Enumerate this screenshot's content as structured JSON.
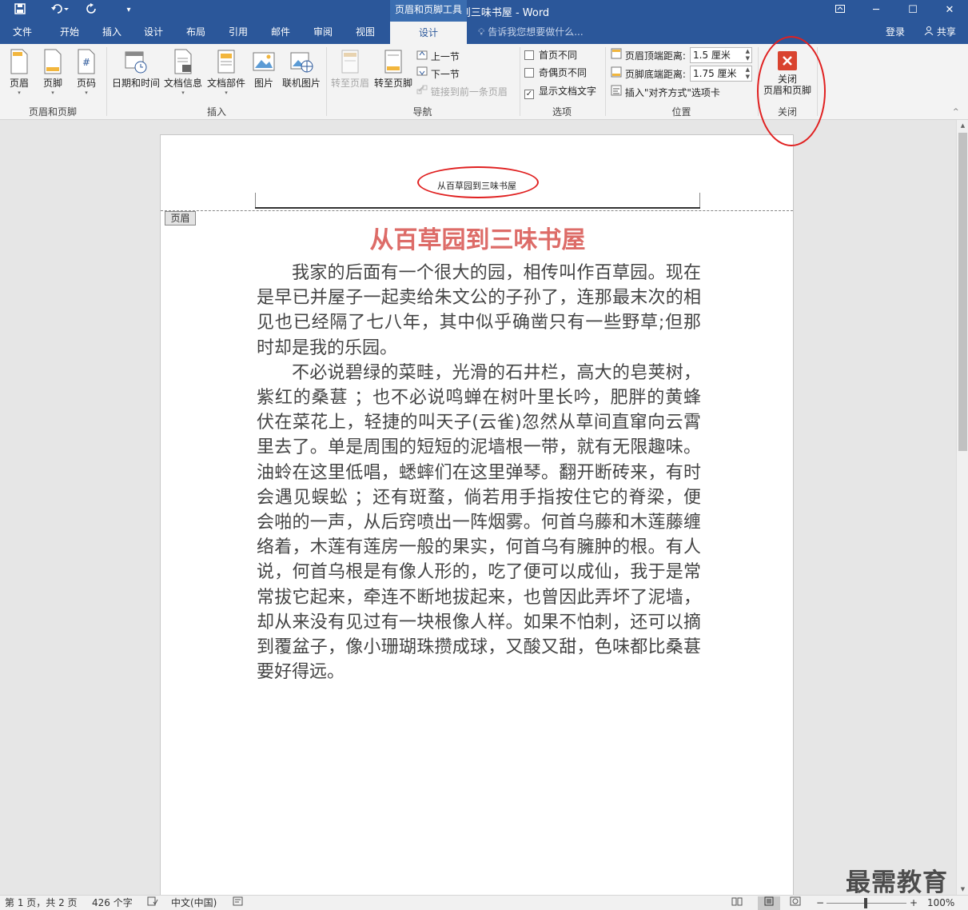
{
  "window": {
    "title": "从百草园到三味书屋 - Word",
    "context_tools": "页眉和页脚工具",
    "tell_me_placeholder": "告诉我您想要做什么...",
    "login": "登录",
    "share": "共享"
  },
  "menu": {
    "tabs": [
      "文件",
      "开始",
      "插入",
      "设计",
      "布局",
      "引用",
      "邮件",
      "审阅",
      "视图",
      "设计"
    ],
    "active_tab_index": 9
  },
  "ribbon": {
    "groups": {
      "header_footer": {
        "label": "页眉和页脚",
        "buttons": [
          "页眉",
          "页脚",
          "页码"
        ]
      },
      "insert": {
        "label": "插入",
        "buttons": [
          "日期和时间",
          "文档信息",
          "文档部件",
          "图片",
          "联机图片"
        ]
      },
      "navigation": {
        "label": "导航",
        "goto_header": "转至页眉",
        "goto_footer": "转至页脚",
        "prev_section": "上一节",
        "next_section": "下一节",
        "link_previous": "链接到前一条页眉"
      },
      "options": {
        "label": "选项",
        "first_page": "首页不同",
        "odd_even": "奇偶页不同",
        "show_doc_text": "显示文档文字"
      },
      "position": {
        "label": "位置",
        "header_from_top_label": "页眉顶端距离:",
        "header_from_top_value": "1.5 厘米",
        "footer_from_bottom_label": "页脚底端距离:",
        "footer_from_bottom_value": "1.75 厘米",
        "insert_align_tab": "插入\"对齐方式\"选项卡"
      },
      "close": {
        "label": "关闭",
        "button_line1": "关闭",
        "button_line2": "页眉和页脚"
      }
    }
  },
  "document": {
    "header_text": "从百草园到三味书屋",
    "header_tag": "页眉",
    "title": "从百草园到三味书屋",
    "paragraphs": [
      "我家的后面有一个很大的园，相传叫作百草园。现在是早已并屋子一起卖给朱文公的子孙了，连那最末次的相见也已经隔了七八年，其中似乎确凿只有一些野草;但那时却是我的乐园。",
      "不必说碧绿的菜畦，光滑的石井栏，高大的皂荚树，紫红的桑葚 ；也不必说鸣蝉在树叶里长吟，肥胖的黄蜂伏在菜花上，轻捷的叫天子(云雀)忽然从草间直窜向云霄里去了。单是周围的短短的泥墙根一带，就有无限趣味。油蛉在这里低唱，蟋蟀们在这里弹琴。翻开断砖来，有时会遇见蜈蚣 ；还有斑蝥，倘若用手指按住它的脊梁，便会啪的一声，从后窍喷出一阵烟雾。何首乌藤和木莲藤缠络着，木莲有莲房一般的果实，何首乌有臃肿的根。有人说，何首乌根是有像人形的，吃了便可以成仙，我于是常常拔它起来，牵连不断地拔起来，也曾因此弄坏了泥墙，却从来没有见过有一块根像人样。如果不怕刺，还可以摘到覆盆子，像小珊瑚珠攒成球，又酸又甜，色味都比桑葚要好得远。"
    ]
  },
  "status": {
    "page": "第 1 页，共 2 页",
    "words": "426 个字",
    "language": "中文(中国)",
    "zoom": "100%"
  },
  "watermark": "最需教育",
  "colors": {
    "brand": "#2b579a",
    "close_red": "#d9432f",
    "title_red": "#dd6c68",
    "annotation": "#e02020"
  }
}
